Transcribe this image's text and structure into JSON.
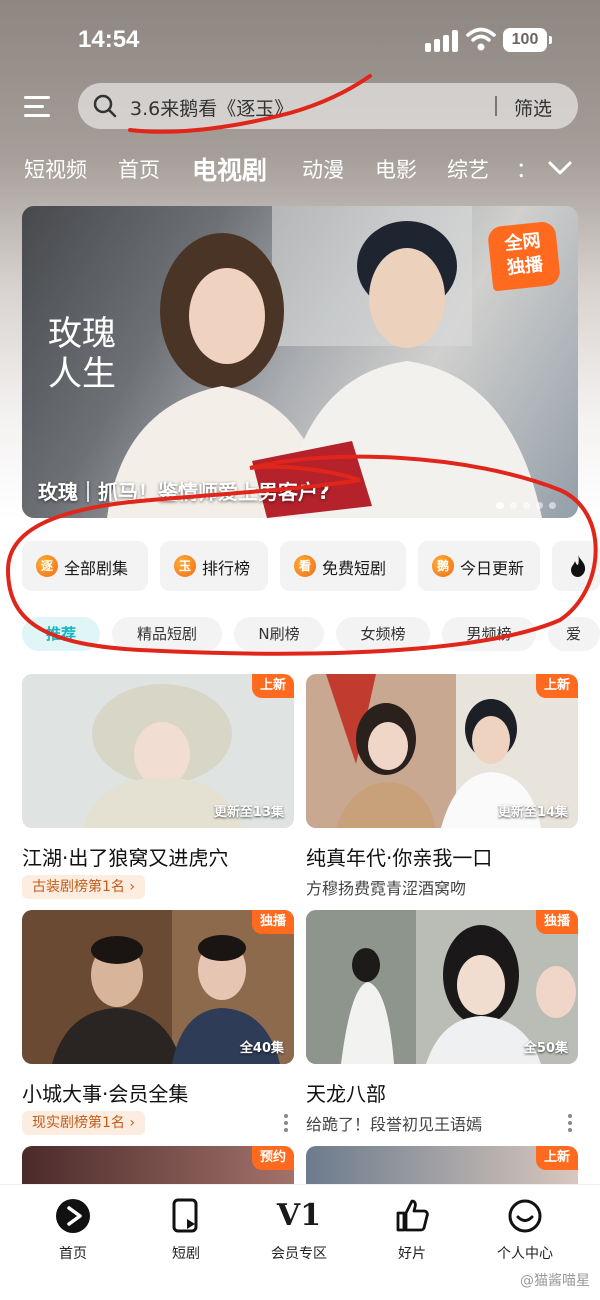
{
  "status_bar": {
    "time": "14:54",
    "battery": "100"
  },
  "search": {
    "text": "3.6来鹅看《逐玉》",
    "filter_label": "筛选"
  },
  "nav_tabs": [
    "短视频",
    "首页",
    "电视剧",
    "动漫",
    "电影",
    "综艺",
    "："
  ],
  "active_tab": "电视剧",
  "banner": {
    "badge_line1": "全网",
    "badge_line2": "独播",
    "logo_text": "玫瑰人生",
    "caption": "玫瑰｜抓马！鉴情师爱上男客户?",
    "slide_count": 5,
    "active_slide": 1
  },
  "quick_entries": [
    {
      "icon_char": "逐",
      "label": "全部剧集"
    },
    {
      "icon_char": "玉",
      "label": "排行榜"
    },
    {
      "icon_char": "看",
      "label": "免费短剧"
    },
    {
      "icon_char": "鹅",
      "label": "今日更新"
    }
  ],
  "chips": [
    "推荐",
    "精品短剧",
    "N刷榜",
    "女频榜",
    "男频榜",
    "爱"
  ],
  "active_chip": "推荐",
  "cards": [
    {
      "tag": "上新",
      "episodes": "更新至13集",
      "title": "江湖·出了狼窝又进虎穴",
      "rank": "古装剧榜第1名 ›",
      "subtitle": ""
    },
    {
      "tag": "上新",
      "episodes": "更新至14集",
      "title": "纯真年代·你亲我一口",
      "rank": "",
      "subtitle": "方穆扬费霓青涩酒窝吻"
    },
    {
      "tag": "独播",
      "episodes": "全40集",
      "title": "小城大事·会员全集",
      "rank": "现实剧榜第1名 ›",
      "subtitle": ""
    },
    {
      "tag": "独播",
      "episodes": "全50集",
      "title": "天龙八部",
      "rank": "",
      "subtitle": "给跪了！段誉初见王语嫣"
    },
    {
      "tag": "预约",
      "episodes": "",
      "title": "",
      "rank": "",
      "subtitle": ""
    },
    {
      "tag": "上新",
      "episodes": "",
      "title": "",
      "rank": "",
      "subtitle": ""
    }
  ],
  "bottom_nav": [
    {
      "icon": "play-icon",
      "label": "首页"
    },
    {
      "icon": "short-drama-icon",
      "label": "短剧"
    },
    {
      "icon": "vip-icon",
      "label": "会员专区",
      "icon_text": "V1"
    },
    {
      "icon": "thumbs-up-icon",
      "label": "好片"
    },
    {
      "icon": "profile-icon",
      "label": "个人中心"
    }
  ],
  "watermark": "@猫酱喵星",
  "colors": {
    "accent_orange": "#ff6a1f",
    "chip_active": "#17b6c2",
    "annotation_red": "#e0261b"
  }
}
